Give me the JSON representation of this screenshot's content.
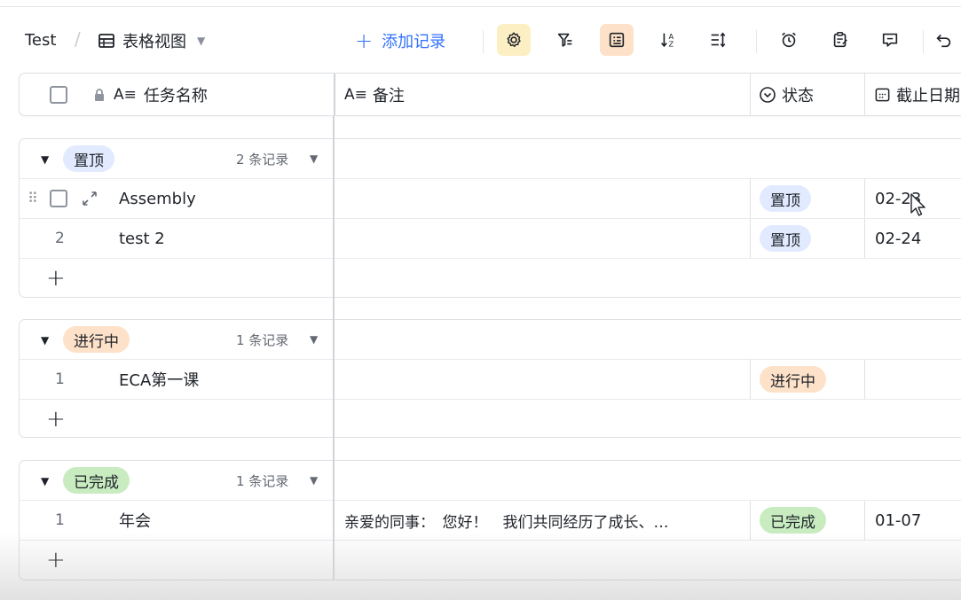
{
  "toolbar": {
    "breadcrumb_root": "Test",
    "view_name": "表格视图",
    "add_record": "添加记录"
  },
  "columns": {
    "task_name": "任务名称",
    "remark": "备注",
    "status": "状态",
    "due_date": "截止日期"
  },
  "groups": [
    {
      "label": "置顶",
      "count": "2 条记录",
      "rows": [
        {
          "num": "",
          "name": "Assembly",
          "remark": "",
          "status": "置顶",
          "due": "02-23"
        },
        {
          "num": "2",
          "name": "test 2",
          "remark": "",
          "status": "置顶",
          "due": "02-24"
        }
      ]
    },
    {
      "label": "进行中",
      "count": "1 条记录",
      "rows": [
        {
          "num": "1",
          "name": "ECA第一课",
          "remark": "",
          "status": "进行中",
          "due": ""
        }
      ]
    },
    {
      "label": "已完成",
      "count": "1 条记录",
      "rows": [
        {
          "num": "1",
          "name": "年会",
          "remark": "亲爱的同事：　您好！　我们共同经历了成长、…",
          "status": "已完成",
          "due": "01-07"
        }
      ]
    }
  ],
  "colors": {
    "accent": "#3370ff",
    "tag_blue": "#e1eaff",
    "tag_orange": "#fde1c8",
    "tag_green": "#c8ecc0",
    "btn_yellow": "#fdefc4"
  }
}
